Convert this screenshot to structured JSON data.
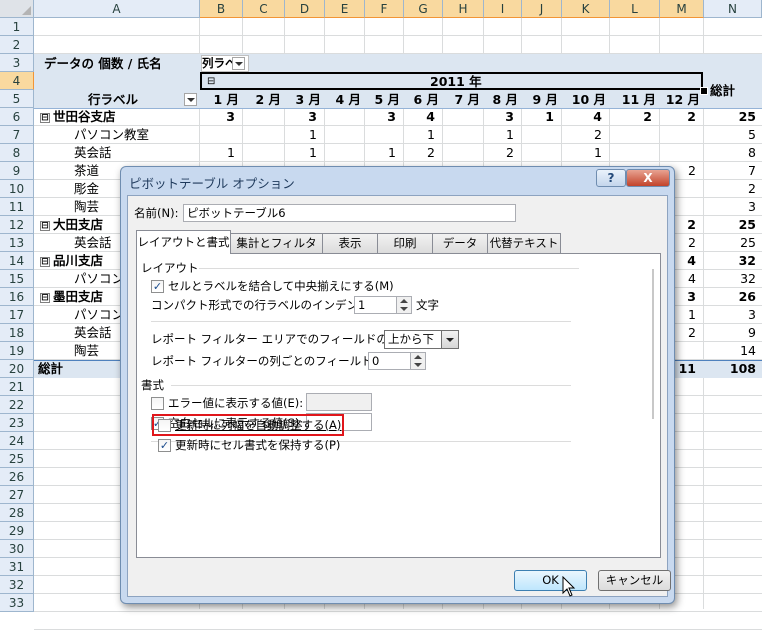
{
  "sheet": {
    "col_headers": [
      "A",
      "B",
      "C",
      "D",
      "E",
      "F",
      "G",
      "H",
      "I",
      "J",
      "K",
      "L",
      "M",
      "N"
    ],
    "row_headers": [
      "1",
      "2",
      "3",
      "4",
      "5",
      "6",
      "7",
      "8",
      "9",
      "10",
      "11",
      "12",
      "13",
      "14",
      "15",
      "16",
      "17",
      "18",
      "19",
      "20",
      "21",
      "22",
      "23",
      "24",
      "25",
      "26",
      "27",
      "28",
      "29",
      "30",
      "31",
      "32",
      "33"
    ],
    "filter_label": "データの 個数 / 氏名",
    "filter_field": "列ラベ",
    "year_label": "2011 年",
    "total_header": "総計",
    "row_label_header": "行ラベル",
    "months": [
      "1 月",
      "2 月",
      "3 月",
      "4 月",
      "5 月",
      "6 月",
      "7 月",
      "8 月",
      "9 月",
      "10 月",
      "11 月",
      "12 月"
    ],
    "rows": [
      {
        "label": "世田谷支店",
        "bold": true,
        "expander": "⊟",
        "vals": [
          "3",
          "",
          "3",
          "",
          "3",
          "4",
          "",
          "3",
          "1",
          "4",
          "2",
          "2",
          "25"
        ]
      },
      {
        "label": "パソコン教室",
        "vals": [
          "",
          "",
          "1",
          "",
          "",
          "1",
          "",
          "1",
          "",
          "2",
          "",
          "",
          "5"
        ]
      },
      {
        "label": "英会話",
        "vals": [
          "1",
          "",
          "1",
          "",
          "1",
          "2",
          "",
          "2",
          "",
          "1",
          "",
          "",
          "8"
        ]
      },
      {
        "label": "茶道",
        "vals": [
          "",
          "",
          "",
          "",
          "",
          "",
          "",
          "",
          "",
          "",
          "",
          "2",
          "7"
        ]
      },
      {
        "label": "彫金",
        "vals": [
          "",
          "",
          "",
          "",
          "",
          "",
          "",
          "",
          "",
          "",
          "",
          "",
          "2"
        ]
      },
      {
        "label": "陶芸",
        "vals": [
          "",
          "",
          "",
          "",
          "",
          "",
          "",
          "",
          "",
          "",
          "",
          "",
          "3"
        ]
      },
      {
        "label": "大田支店",
        "bold": true,
        "expander": "⊟",
        "vals": [
          "",
          "",
          "",
          "",
          "",
          "",
          "",
          "",
          "",
          "",
          "",
          "2",
          "25"
        ]
      },
      {
        "label": "英会話",
        "vals": [
          "",
          "",
          "",
          "",
          "",
          "",
          "",
          "",
          "",
          "",
          "",
          "2",
          "25"
        ]
      },
      {
        "label": "品川支店",
        "bold": true,
        "expander": "⊟",
        "vals": [
          "",
          "",
          "",
          "",
          "",
          "",
          "",
          "",
          "",
          "",
          "",
          "4",
          "32"
        ]
      },
      {
        "label": "パソコン",
        "vals": [
          "",
          "",
          "",
          "",
          "",
          "",
          "",
          "",
          "",
          "",
          "",
          "4",
          "32"
        ]
      },
      {
        "label": "墨田支店",
        "bold": true,
        "expander": "⊟",
        "vals": [
          "",
          "",
          "",
          "",
          "",
          "",
          "",
          "",
          "",
          "",
          "",
          "3",
          "26"
        ]
      },
      {
        "label": "パソコン",
        "vals": [
          "",
          "",
          "",
          "",
          "",
          "",
          "",
          "",
          "",
          "",
          "",
          "1",
          "3"
        ]
      },
      {
        "label": "英会話",
        "vals": [
          "",
          "",
          "",
          "",
          "",
          "",
          "",
          "",
          "",
          "",
          "",
          "2",
          "9"
        ]
      },
      {
        "label": "陶芸",
        "vals": [
          "",
          "",
          "",
          "",
          "",
          "",
          "",
          "",
          "",
          "",
          "",
          "",
          "14"
        ]
      },
      {
        "label": "総計",
        "bold": true,
        "vals": [
          "",
          "",
          "",
          "",
          "",
          "",
          "",
          "",
          "",
          "",
          "",
          "11",
          "108"
        ]
      }
    ]
  },
  "dialog": {
    "title": "ピボットテーブル オプション",
    "help_label": "?",
    "close_label": "X",
    "name_label": "名前(N):",
    "name_value": "ピボットテーブル6",
    "tabs": [
      "レイアウトと書式",
      "集計とフィルター",
      "表示",
      "印刷",
      "データ",
      "代替テキスト"
    ],
    "section_layout": "レイアウト",
    "merge_label": "セルとラベルを結合して中央揃えにする(M)",
    "indent_label": "コンパクト形式での行ラベルのインデント(C):",
    "indent_value": "1",
    "indent_unit": "文字",
    "report_filter_label": "レポート フィルター エリアでのフィールドの表示(D):",
    "report_filter_value": "上から下",
    "fields_per_col_label": "レポート フィルターの列ごとのフィールド数(F):",
    "fields_per_col_value": "0",
    "section_format": "書式",
    "error_label": "エラー値に表示する値(E):",
    "empty_label": "空白セルに表示する値(S):",
    "autofit_label": "更新時に列幅を自動調整する(A)",
    "preserve_label": "更新時にセル書式を保持する(P)",
    "ok_label": "OK",
    "cancel_label": "キャンセル",
    "checkmark": "✓"
  }
}
